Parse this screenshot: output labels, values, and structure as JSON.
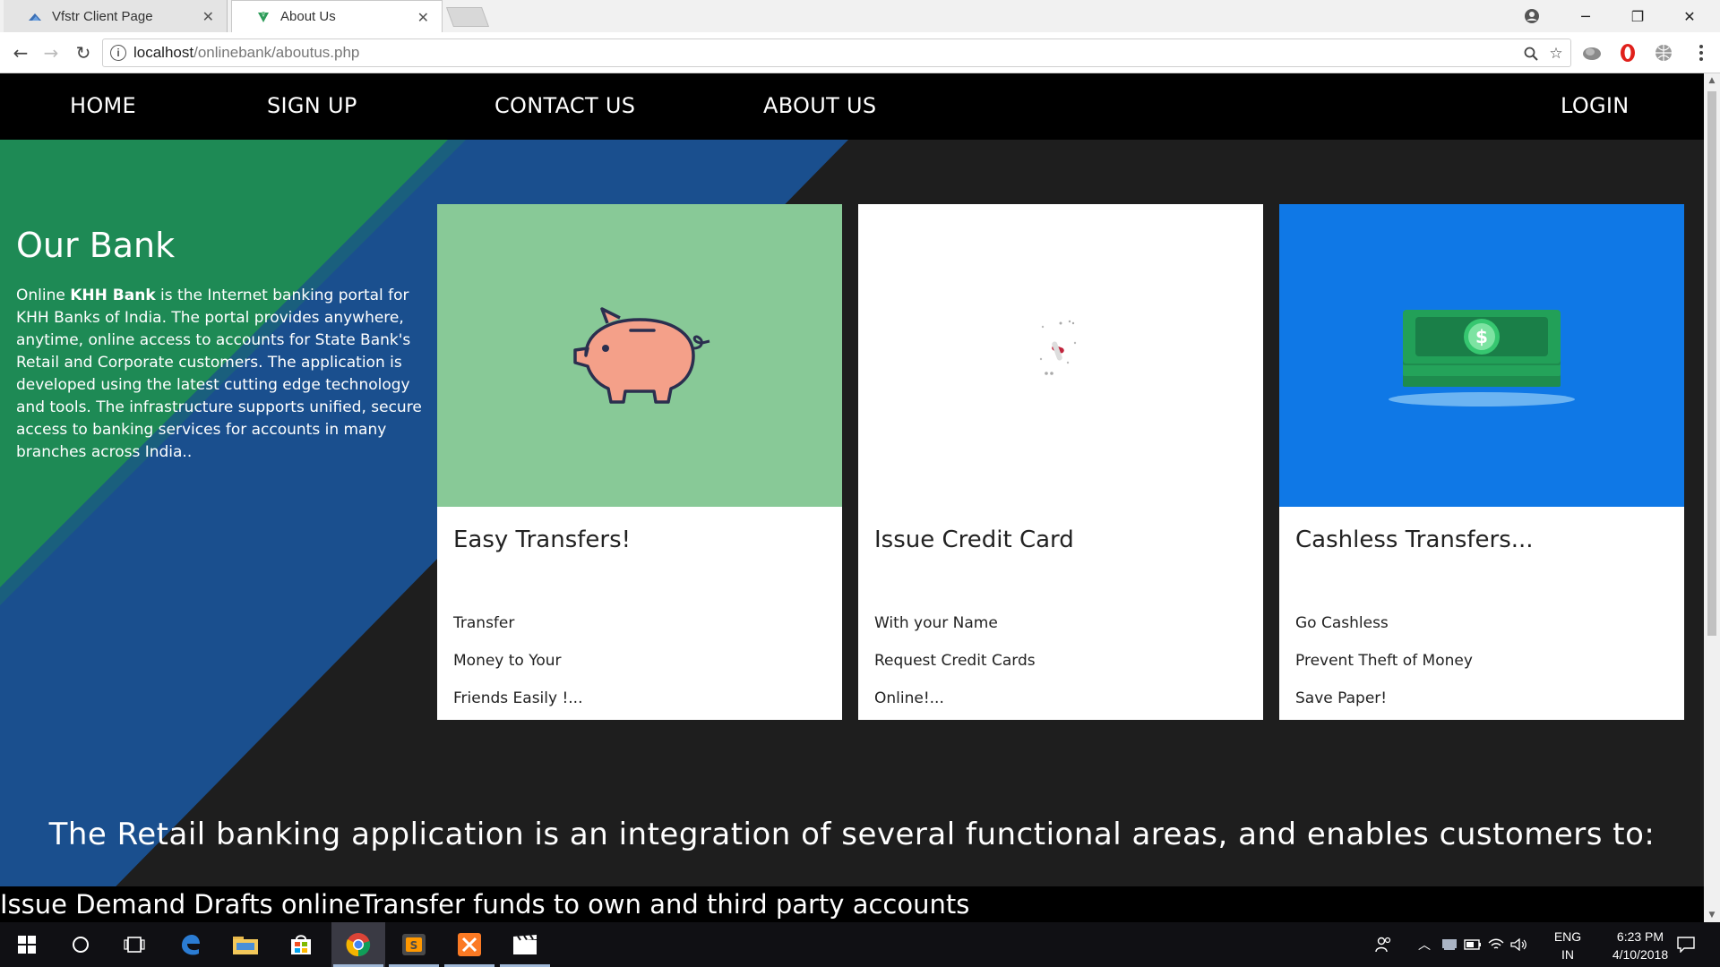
{
  "browser": {
    "tabs": [
      {
        "title": "Vfstr Client Page",
        "active": false
      },
      {
        "title": "About Us",
        "active": true
      }
    ],
    "url_host": "localhost",
    "url_path": "/onlinebank/aboutus.php"
  },
  "nav": {
    "home": "HOME",
    "signup": "SIGN UP",
    "contact": "CONTACT US",
    "about": "ABOUT US",
    "login": "LOGIN"
  },
  "about": {
    "title": "Our Bank",
    "text_prefix": "Online ",
    "bank_name": "KHH Bank",
    "text_suffix": " is the Internet banking portal for KHH Banks of India. The portal provides anywhere, anytime, online access to accounts for State Bank's Retail and Corporate customers. The application is developed using the latest cutting edge technology and tools. The infrastructure supports unified, secure access to banking services for accounts in many branches across India.."
  },
  "cards": [
    {
      "title": "Easy Transfers!",
      "lines": [
        "Transfer",
        "Money to Your",
        "Friends Easily !..."
      ],
      "image_color": "#88c997",
      "icon": "piggy-bank-icon"
    },
    {
      "title": "Issue Credit Card",
      "lines": [
        "With your Name",
        "Request Credit Cards",
        "Online!..."
      ],
      "image_color": "#ffffff",
      "icon": "loading-spinner-icon"
    },
    {
      "title": "Cashless Transfers...",
      "lines": [
        "Go Cashless",
        "Prevent Theft of Money",
        "Save Paper!"
      ],
      "image_color": "#0f78e6",
      "icon": "cash-stack-icon"
    }
  ],
  "retail_heading": "The Retail banking application is an integration of several functional areas, and enables customers to:",
  "marquee_text": "Issue Demand Drafts onlineTransfer funds to own and third party accounts",
  "taskbar": {
    "lang_top": "ENG",
    "lang_bottom": "IN",
    "time": "6:23 PM",
    "date": "4/10/2018"
  },
  "colors": {
    "hero_green": "#1e8a55",
    "hero_blue": "#1a4f8e",
    "page_dark": "#1e1e1e",
    "nav_black": "#000000"
  }
}
